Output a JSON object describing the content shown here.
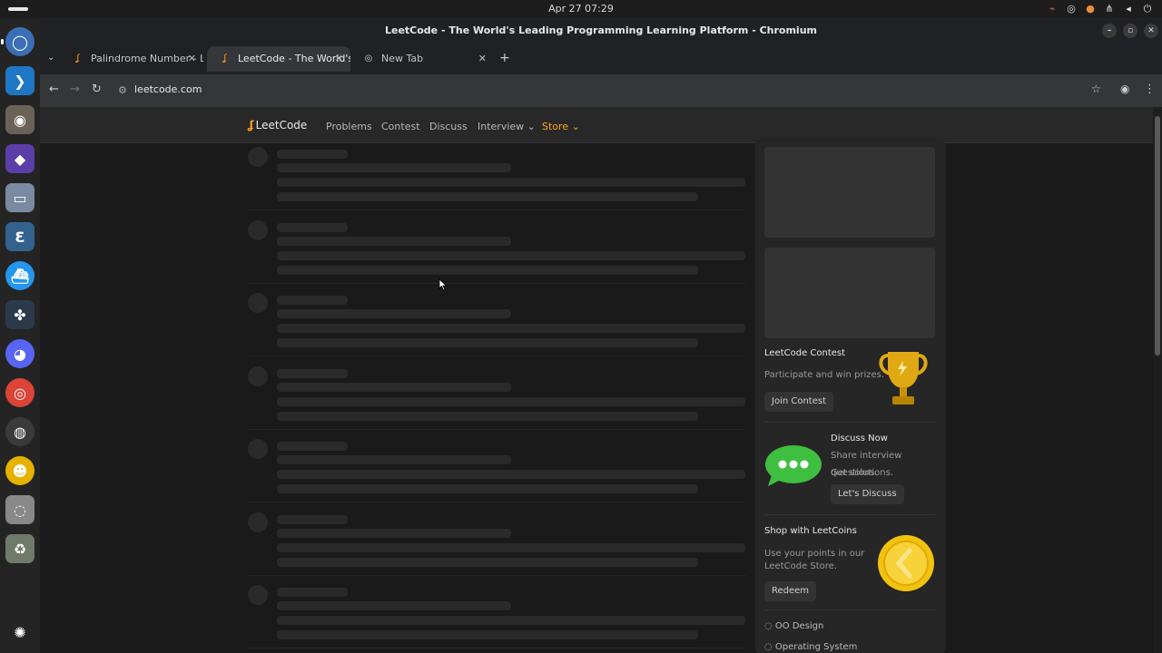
{
  "system": {
    "clock": "Apr 27  07:29",
    "tray_icons": [
      "mic-off-icon",
      "steam-icon",
      "microphone-icon",
      "network-icon",
      "volume-icon",
      "power-icon"
    ]
  },
  "dock": {
    "apps": [
      "chromium",
      "vscode",
      "gimp",
      "obsidian",
      "files",
      "postgresql",
      "docker",
      "davinci-resolve",
      "discord",
      "chrome",
      "obs",
      "beekeeper",
      "disk",
      "trash",
      "ubuntu"
    ]
  },
  "window": {
    "title": "LeetCode - The World's Leading Programming Learning Platform - Chromium"
  },
  "tabs": [
    {
      "label": "Palindrome Number - Le",
      "active": false
    },
    {
      "label": "LeetCode - The World's Le",
      "active": true
    },
    {
      "label": "New Tab",
      "active": false
    }
  ],
  "address_bar": {
    "url": "leetcode.com"
  },
  "leetcode": {
    "logo_text": "LeetCode",
    "nav": {
      "problems": "Problems",
      "contest": "Contest",
      "discuss": "Discuss",
      "interview": "Interview",
      "store": "Store"
    },
    "sidebar": {
      "contest": {
        "title": "LeetCode Contest",
        "text": "Participate and win prizes.",
        "button": "Join Contest"
      },
      "discuss": {
        "title": "Discuss Now",
        "text1": "Share interview questions.",
        "text2": "Get solutions.",
        "button": "Let's Discuss"
      },
      "shop": {
        "title": "Shop with LeetCoins",
        "text1": "Use your points in our",
        "text2": "LeetCode Store.",
        "button": "Redeem"
      },
      "links": [
        "OO Design",
        "Operating System"
      ]
    },
    "accent_color": "#ffa116"
  }
}
